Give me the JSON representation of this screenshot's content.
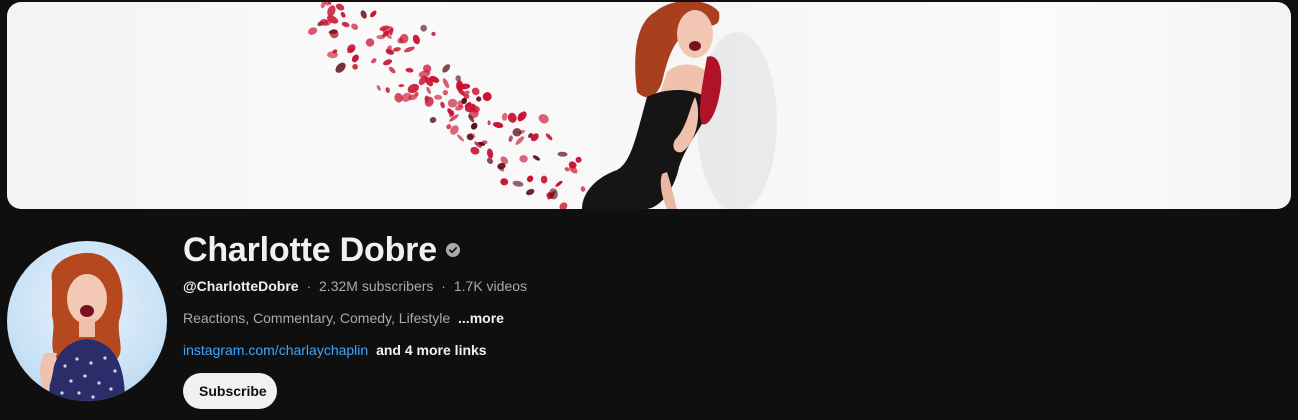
{
  "channel": {
    "name": "Charlotte Dobre",
    "verified_icon": "verified-check-icon",
    "handle": "@CharlotteDobre",
    "separator": "·",
    "subscribers": "2.32M subscribers",
    "videos": "1.7K videos",
    "description": "Reactions, Commentary, Comedy, Lifestyle",
    "more_label": "...more",
    "link_text": "instagram.com/charlaychaplin",
    "more_links_label": "and 4 more links",
    "subscribe_label": "Subscribe"
  },
  "colors": {
    "background": "#0f0f0f",
    "text_primary": "#f1f1f1",
    "text_secondary": "#aaaaaa",
    "link": "#3ea6ff",
    "button_bg": "#f1f1f1"
  }
}
